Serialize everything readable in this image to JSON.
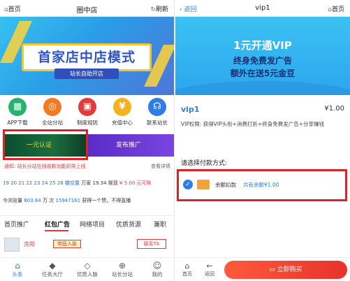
{
  "left": {
    "nav": {
      "home": "首页",
      "title": "圈中店",
      "refresh": "刷新"
    },
    "banner": {
      "title": "首家店中店模式",
      "subtitle": "站长自助开店"
    },
    "icons": [
      {
        "label": "APP下载",
        "color": "#27b36f",
        "glyph": "▦"
      },
      {
        "label": "全站分站",
        "color": "#f47a22",
        "glyph": "◎"
      },
      {
        "label": "制度规则",
        "color": "#e23b3b",
        "glyph": "▣"
      },
      {
        "label": "充值中心",
        "color": "#f6b21d",
        "glyph": "¥"
      },
      {
        "label": "联系站长",
        "color": "#2e7de8",
        "glyph": "☊"
      }
    ],
    "promo": {
      "verify": "一元认证",
      "publish": "发布推广"
    },
    "notice": {
      "text": "通知: 站长分站在线收款功能彩排上线",
      "more": "查看详情"
    },
    "ticker": {
      "nums": "19 20 21 22 23 24 25 26 楼空置",
      "coin_text": "万家 19.34 叛现",
      "price": "¥ 5.00 元可购"
    },
    "visit": {
      "prefix": "今浏览量",
      "count": "803.64",
      "unit": "万 次",
      "user": "15947161",
      "suffix": "获得一个赞。不得直播"
    },
    "tabs": [
      "首页推广",
      "红包广告",
      "网络项目",
      "优质货源",
      "兼职"
    ],
    "ad": {
      "name": "贪阳",
      "badge": "带庭人脉",
      "contact": "联系TA"
    },
    "bottom_nav": [
      {
        "label": "头条",
        "glyph": "⌂"
      },
      {
        "label": "任务大厅",
        "glyph": "◆"
      },
      {
        "label": "优质人脉",
        "glyph": "◇"
      },
      {
        "label": "站长分站",
        "glyph": "⊕"
      },
      {
        "label": "我的",
        "glyph": "☺"
      }
    ]
  },
  "right": {
    "nav": {
      "back": "返回",
      "title": "vip1",
      "home": "首页"
    },
    "banner": {
      "line1": "1元开通VIP",
      "line2": "终身免费发广告",
      "line3": "额外在送5元金豆"
    },
    "product": {
      "title": "vip1",
      "price": "¥1.00",
      "desc": "VIP权限: 获得VIP头衔+消费打折+终身免费发广告+分享赚钱"
    },
    "pay": {
      "label": "请选择付款方式:",
      "method": "余额扣款",
      "balance": "共有余额¥1.00"
    },
    "bottom": {
      "home": "首页",
      "back": "返回",
      "buy": "立即购买"
    }
  }
}
